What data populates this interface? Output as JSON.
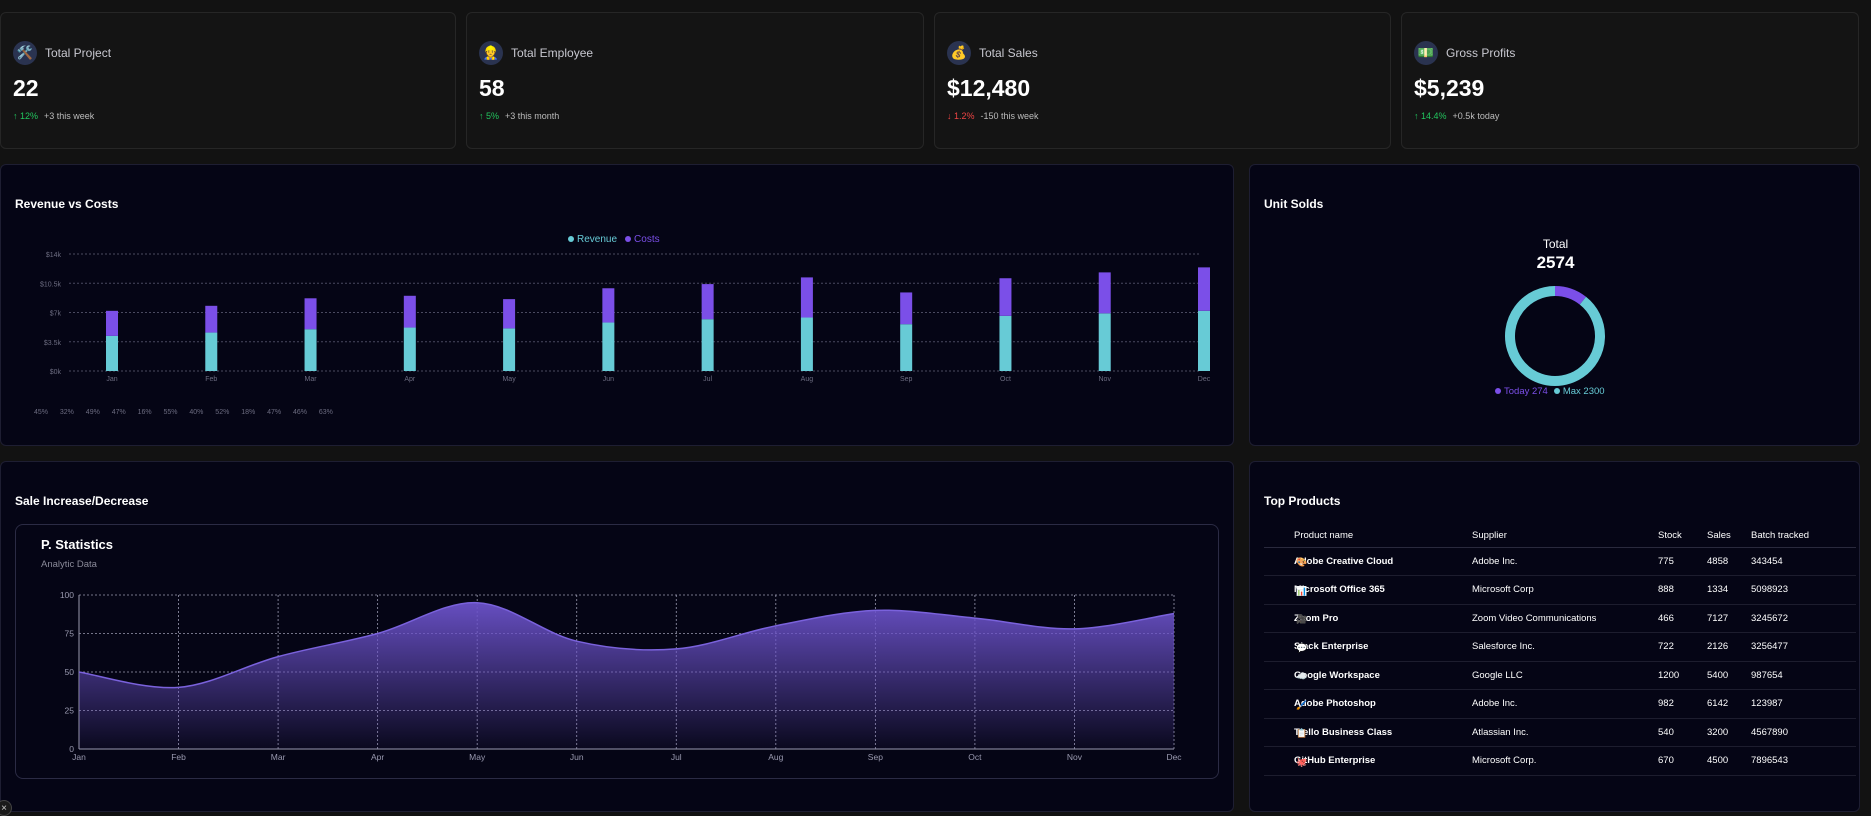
{
  "stats": [
    {
      "title": "Total Project",
      "icon": "tools-icon",
      "glyph": "🛠️",
      "value": "22",
      "direction": "up",
      "pct": "12%",
      "note": "+3 this week"
    },
    {
      "title": "Total Employee",
      "icon": "person-icon",
      "glyph": "👷",
      "value": "58",
      "direction": "up",
      "pct": "5%",
      "note": "+3 this month"
    },
    {
      "title": "Total Sales",
      "icon": "money-bag-icon",
      "glyph": "💰",
      "value": "$12,480",
      "direction": "down",
      "pct": "1.2%",
      "note": "-150 this week"
    },
    {
      "title": "Gross Profits",
      "icon": "banknote-icon",
      "glyph": "💵",
      "value": "$5,239",
      "direction": "up",
      "pct": "14.4%",
      "note": "+0.5k today"
    }
  ],
  "revenue_panel": {
    "title": "Revenue vs Costs"
  },
  "unit_panel": {
    "title": "Unit Solds",
    "total_label": "Total",
    "total_value": "2574",
    "legend_today": "Today 274",
    "legend_max": "Max 2300"
  },
  "sale_panel": {
    "title": "Sale Increase/Decrease",
    "inner_title": "P. Statistics",
    "inner_subtitle": "Analytic Data"
  },
  "products": {
    "title": "Top Products",
    "headers": [
      "Product name",
      "Supplier",
      "Stock",
      "Sales",
      "Batch tracked"
    ],
    "rows": [
      {
        "icon": "palette-icon",
        "glyph": "🎨",
        "name": "Adobe Creative Cloud",
        "supplier": "Adobe Inc.",
        "stock": "775",
        "sales": "4858",
        "batch": "343454"
      },
      {
        "icon": "chart-icon",
        "glyph": "📊",
        "name": "Microsoft Office 365",
        "supplier": "Microsoft Corp",
        "stock": "888",
        "sales": "1334",
        "batch": "5098923"
      },
      {
        "icon": "video-icon",
        "glyph": "🎥",
        "name": "Zoom Pro",
        "supplier": "Zoom Video Communications",
        "stock": "466",
        "sales": "7127",
        "batch": "3245672"
      },
      {
        "icon": "speech-bubble-icon",
        "glyph": "💬",
        "name": "Slack Enterprise",
        "supplier": "Salesforce Inc.",
        "stock": "722",
        "sales": "2126",
        "batch": "3256477"
      },
      {
        "icon": "cloud-icon",
        "glyph": "☁️",
        "name": "Google Workspace",
        "supplier": "Google LLC",
        "stock": "1200",
        "sales": "5400",
        "batch": "987654"
      },
      {
        "icon": "brush-icon",
        "glyph": "🖌️",
        "name": "Adobe Photoshop",
        "supplier": "Adobe Inc.",
        "stock": "982",
        "sales": "6142",
        "batch": "123987"
      },
      {
        "icon": "clipboard-icon",
        "glyph": "📋",
        "name": "Trello Business Class",
        "supplier": "Atlassian Inc.",
        "stock": "540",
        "sales": "3200",
        "batch": "4567890"
      },
      {
        "icon": "octocat-icon",
        "glyph": "🐙",
        "name": "GitHub Enterprise",
        "supplier": "Microsoft Corp.",
        "stock": "670",
        "sales": "4500",
        "batch": "7896543"
      }
    ]
  },
  "colors": {
    "revenue": "#67cbd6",
    "costs": "#7b4fe8",
    "area": "#6b52c9",
    "up": "#22c55e",
    "down": "#ef4444"
  },
  "chart_data": [
    {
      "type": "bar",
      "stacked": true,
      "categories": [
        "Jan",
        "Feb",
        "Mar",
        "Apr",
        "May",
        "Jun",
        "Jul",
        "Aug",
        "Sep",
        "Oct",
        "Nov",
        "Dec"
      ],
      "series": [
        {
          "name": "Revenue",
          "values": [
            4200,
            4600,
            5000,
            5200,
            5100,
            5800,
            6200,
            6400,
            5600,
            6600,
            6900,
            7200
          ]
        },
        {
          "name": "Costs",
          "values": [
            3000,
            3200,
            3700,
            3800,
            3500,
            4100,
            4200,
            4800,
            3800,
            4500,
            4900,
            5200
          ]
        }
      ],
      "percent_labels": [
        "45%",
        "32%",
        "49%",
        "47%",
        "16%",
        "55%",
        "40%",
        "52%",
        "18%",
        "47%",
        "46%",
        "63%"
      ],
      "ytick_labels": [
        "$0k",
        "$3.5k",
        "$7k",
        "$10.5k",
        "$14k"
      ],
      "ylim": [
        0,
        14000
      ],
      "legend": "top-center",
      "grid": true
    },
    {
      "type": "pie",
      "donut": true,
      "labels": [
        "Today",
        "Max"
      ],
      "values": [
        274,
        2300
      ],
      "total": 2574
    },
    {
      "type": "area",
      "categories": [
        "Jan",
        "Feb",
        "Mar",
        "Apr",
        "May",
        "Jun",
        "Jul",
        "Aug",
        "Sep",
        "Oct",
        "Nov",
        "Dec"
      ],
      "values": [
        50,
        40,
        60,
        75,
        95,
        70,
        65,
        80,
        90,
        85,
        78,
        88
      ],
      "ylim": [
        0,
        100
      ],
      "yticks": [
        0,
        25,
        50,
        75,
        100
      ],
      "grid": true
    }
  ]
}
